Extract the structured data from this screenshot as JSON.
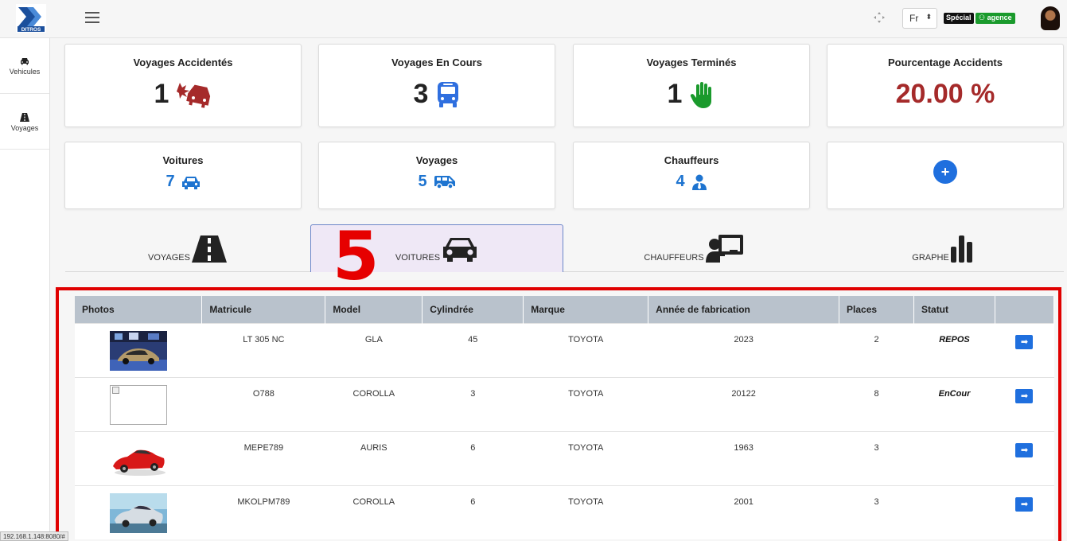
{
  "header": {
    "logo_text": "DITROS",
    "language": "Fr",
    "badge_role": "Spécial",
    "badge_agency": "agence"
  },
  "sidebar": {
    "items": [
      {
        "label": "Vehicules",
        "icon": "car-icon"
      },
      {
        "label": "Voyages",
        "icon": "road-icon"
      }
    ]
  },
  "stats": [
    {
      "title": "Voyages Accidentés",
      "value": "1",
      "icon": "car-crash-icon",
      "color": "#a52a2a"
    },
    {
      "title": "Voyages En Cours",
      "value": "3",
      "icon": "bus-icon",
      "color": "#2f6fdf"
    },
    {
      "title": "Voyages Terminés",
      "value": "1",
      "icon": "hand-stop-icon",
      "color": "#1a9a2c"
    },
    {
      "title": "Pourcentage Accidents",
      "value": "20.00 %",
      "color": "#a52a2a"
    }
  ],
  "counts": [
    {
      "title": "Voitures",
      "value": "7",
      "icon": "car-icon"
    },
    {
      "title": "Voyages",
      "value": "5",
      "icon": "van-icon"
    },
    {
      "title": "Chauffeurs",
      "value": "4",
      "icon": "user-tie-icon"
    },
    {
      "title": "",
      "action": "+"
    }
  ],
  "tabs": [
    {
      "label": "VOYAGES",
      "icon": "road-icon",
      "active": false
    },
    {
      "label": "VOITURES",
      "icon": "car-icon",
      "active": true
    },
    {
      "label": "CHAUFFEURS",
      "icon": "chalkboard-teacher-icon",
      "active": false
    },
    {
      "label": "GRAPHE",
      "icon": "bar-chart-icon",
      "active": false
    }
  ],
  "annotation": "5",
  "table": {
    "headers": [
      "Photos",
      "Matricule",
      "Model",
      "Cylindrée",
      "Marque",
      "Année de fabrication",
      "Places",
      "Statut",
      ""
    ],
    "rows": [
      {
        "photo": "car-showroom-photo",
        "matricule": "LT 305 NC",
        "model": "GLA",
        "cylindree": "45",
        "marque": "TOYOTA",
        "annee": "2023",
        "places": "2",
        "statut": "REPOS"
      },
      {
        "photo": "broken-image",
        "matricule": "O788",
        "model": "COROLLA",
        "cylindree": "3",
        "marque": "TOYOTA",
        "annee": "20122",
        "places": "8",
        "statut": "EnCour"
      },
      {
        "photo": "red-sports-car-photo",
        "matricule": "MEPE789",
        "model": "AURIS",
        "cylindree": "6",
        "marque": "TOYOTA",
        "annee": "1963",
        "places": "3",
        "statut": ""
      },
      {
        "photo": "silver-sedan-photo",
        "matricule": "MKOLPM789",
        "model": "COROLLA",
        "cylindree": "6",
        "marque": "TOYOTA",
        "annee": "2001",
        "places": "3",
        "statut": ""
      }
    ]
  },
  "status_url": "192.168.1.148:8080/#"
}
